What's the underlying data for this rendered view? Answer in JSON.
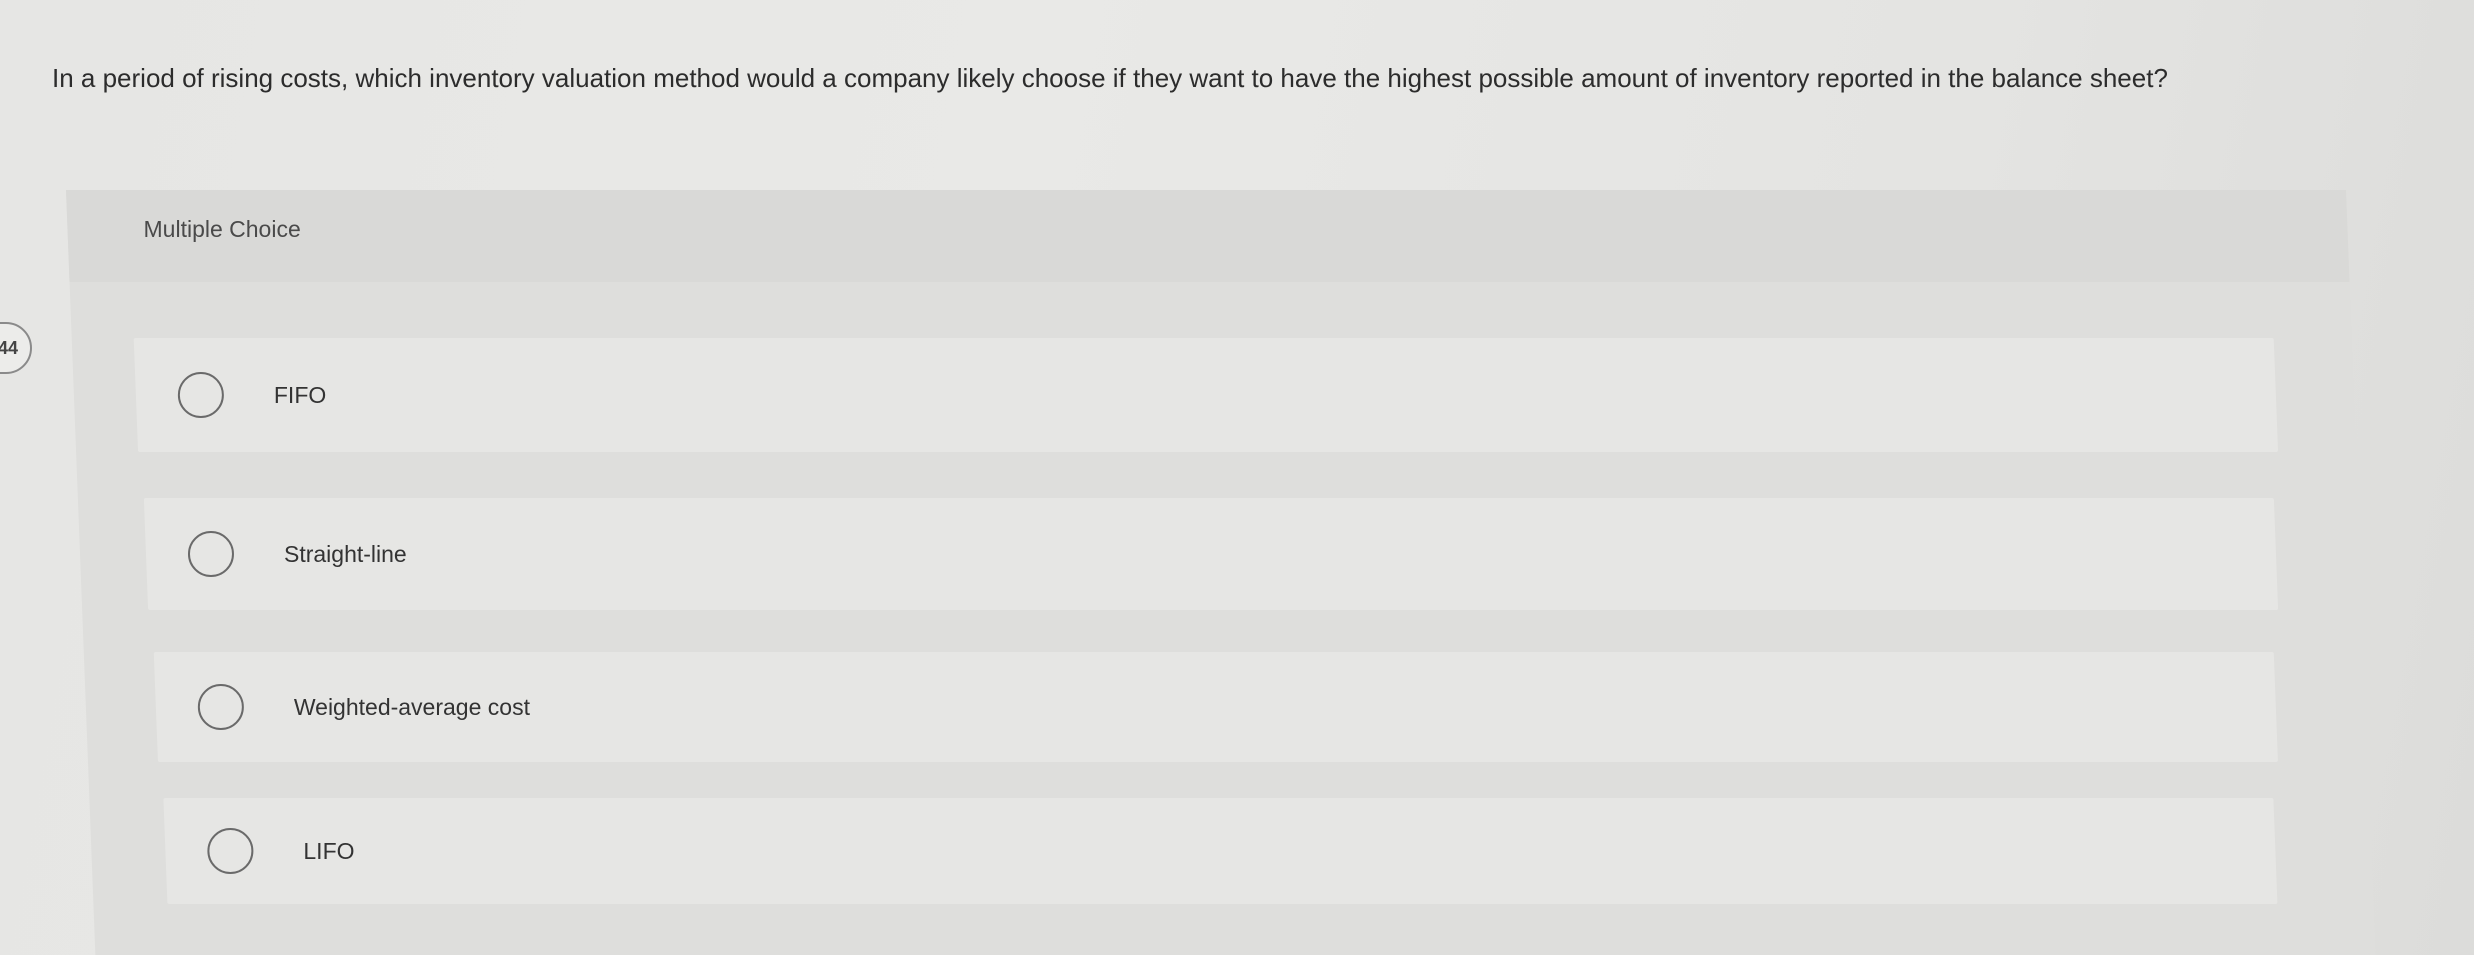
{
  "question_number": "44",
  "question_text": "In a period of rising costs, which inventory valuation method would a company likely choose if they want to have the highest possible amount of inventory reported in the balance sheet?",
  "multiple_choice": {
    "title": "Multiple Choice",
    "options": [
      {
        "label": "FIFO"
      },
      {
        "label": "Straight-line"
      },
      {
        "label": "Weighted-average cost"
      },
      {
        "label": "LIFO"
      }
    ]
  }
}
